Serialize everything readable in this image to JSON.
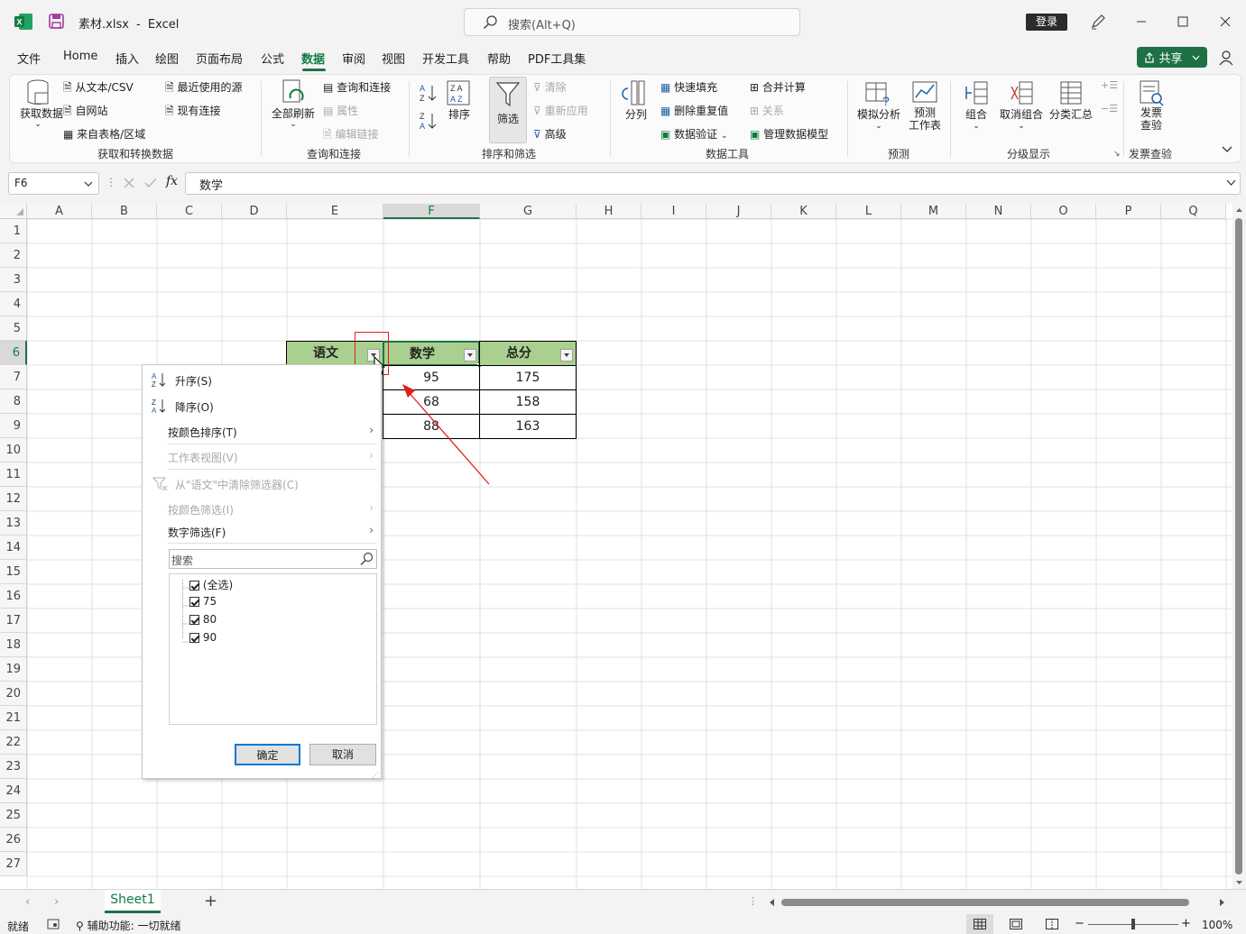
{
  "titlebar": {
    "filename": "素材.xlsx",
    "separator": "-",
    "app": "Excel",
    "search_placeholder": "搜索(Alt+Q)",
    "login": "登录"
  },
  "menu": {
    "tabs": [
      "文件",
      "Home",
      "插入",
      "绘图",
      "页面布局",
      "公式",
      "数据",
      "审阅",
      "视图",
      "开发工具",
      "帮助",
      "PDF工具集"
    ],
    "active": "数据",
    "share": "共享"
  },
  "ribbon": {
    "get_data": "获取数据",
    "from_text_csv": "从文本/CSV",
    "from_web": "自网站",
    "from_table": "来自表格/区域",
    "recent_sources": "最近使用的源",
    "existing_conn": "现有连接",
    "group_get": "获取和转换数据",
    "refresh_all": "全部刷新",
    "queries_conn": "查询和连接",
    "properties": "属性",
    "edit_links": "编辑链接",
    "group_query": "查询和连接",
    "sort_az": "A↓Z",
    "sort_za": "Z↓A",
    "sort": "排序",
    "filter": "筛选",
    "clear": "清除",
    "reapply": "重新应用",
    "advanced": "高级",
    "group_sort": "排序和筛选",
    "text_to_columns": "分列",
    "flash_fill": "快速填充",
    "remove_dup": "删除重复值",
    "data_validation": "数据验证",
    "consolidate": "合并计算",
    "relationships": "关系",
    "manage_model": "管理数据模型",
    "group_tools": "数据工具",
    "what_if": "模拟分析",
    "forecast_sheet": "预测\n工作表",
    "group_forecast": "预测",
    "group": "组合",
    "ungroup": "取消组合",
    "subtotal": "分类汇总",
    "group_outline": "分级显示",
    "invoice_check": "发票\n查验",
    "group_invoice": "发票查验"
  },
  "formula_bar": {
    "namebox": "F6",
    "fx": "fx",
    "value": "数学"
  },
  "columns": [
    "A",
    "B",
    "C",
    "D",
    "E",
    "F",
    "G",
    "H",
    "I",
    "J",
    "K",
    "L",
    "M",
    "N",
    "O",
    "P",
    "Q"
  ],
  "rows": [
    "1",
    "2",
    "3",
    "4",
    "5",
    "6",
    "7",
    "8",
    "9",
    "10",
    "11",
    "12",
    "13",
    "14",
    "15",
    "16",
    "17",
    "18",
    "19",
    "20",
    "21",
    "22",
    "23",
    "24",
    "25",
    "26",
    "27"
  ],
  "table": {
    "headers": [
      "语文",
      "数学",
      "总分"
    ],
    "math": [
      "95",
      "68",
      "88"
    ],
    "total": [
      "175",
      "158",
      "163"
    ]
  },
  "filter_menu": {
    "sort_asc": "升序(S)",
    "sort_desc": "降序(O)",
    "sort_by_color": "按颜色排序(T)",
    "sheet_view": "工作表视图(V)",
    "clear_filter": "从\"语文\"中清除筛选器(C)",
    "filter_by_color": "按颜色筛选(I)",
    "number_filter": "数字筛选(F)",
    "search_placeholder": "搜索",
    "items": [
      "(全选)",
      "75",
      "80",
      "90"
    ],
    "ok": "确定",
    "cancel": "取消"
  },
  "sheets": {
    "active": "Sheet1",
    "add": "+"
  },
  "status": {
    "ready": "就绪",
    "accessibility": "辅助功能: 一切就绪",
    "zoom": "100%"
  }
}
